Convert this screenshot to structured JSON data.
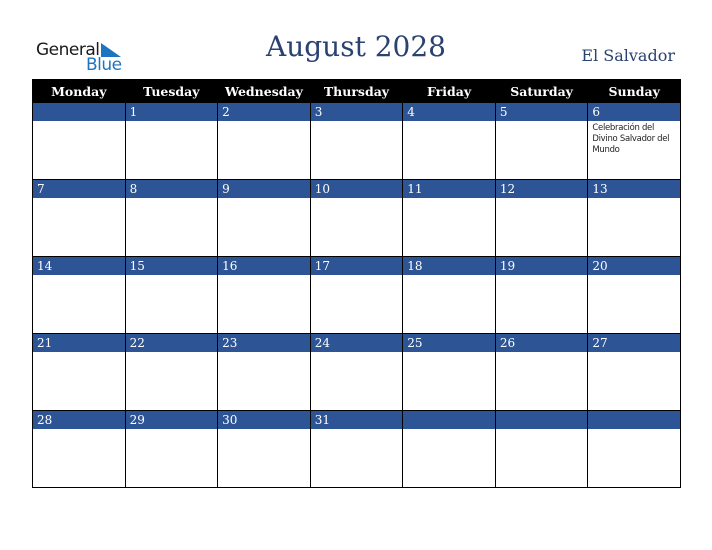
{
  "logo": {
    "line1": "General",
    "line2": "Blue"
  },
  "title": "August 2028",
  "country": "El Salvador",
  "colors": {
    "header_bg": "#000000",
    "day_bar": "#2d5494",
    "title": "#2a4270",
    "logo_blue": "#1f74c1"
  },
  "weekdays": [
    "Monday",
    "Tuesday",
    "Wednesday",
    "Thursday",
    "Friday",
    "Saturday",
    "Sunday"
  ],
  "weeks": [
    {
      "days": [
        {
          "num": "",
          "event": ""
        },
        {
          "num": "1",
          "event": ""
        },
        {
          "num": "2",
          "event": ""
        },
        {
          "num": "3",
          "event": ""
        },
        {
          "num": "4",
          "event": ""
        },
        {
          "num": "5",
          "event": ""
        },
        {
          "num": "6",
          "event": "Celebración del Divino Salvador del Mundo"
        }
      ]
    },
    {
      "days": [
        {
          "num": "7",
          "event": ""
        },
        {
          "num": "8",
          "event": ""
        },
        {
          "num": "9",
          "event": ""
        },
        {
          "num": "10",
          "event": ""
        },
        {
          "num": "11",
          "event": ""
        },
        {
          "num": "12",
          "event": ""
        },
        {
          "num": "13",
          "event": ""
        }
      ]
    },
    {
      "days": [
        {
          "num": "14",
          "event": ""
        },
        {
          "num": "15",
          "event": ""
        },
        {
          "num": "16",
          "event": ""
        },
        {
          "num": "17",
          "event": ""
        },
        {
          "num": "18",
          "event": ""
        },
        {
          "num": "19",
          "event": ""
        },
        {
          "num": "20",
          "event": ""
        }
      ]
    },
    {
      "days": [
        {
          "num": "21",
          "event": ""
        },
        {
          "num": "22",
          "event": ""
        },
        {
          "num": "23",
          "event": ""
        },
        {
          "num": "24",
          "event": ""
        },
        {
          "num": "25",
          "event": ""
        },
        {
          "num": "26",
          "event": ""
        },
        {
          "num": "27",
          "event": ""
        }
      ]
    },
    {
      "days": [
        {
          "num": "28",
          "event": ""
        },
        {
          "num": "29",
          "event": ""
        },
        {
          "num": "30",
          "event": ""
        },
        {
          "num": "31",
          "event": ""
        },
        {
          "num": "",
          "event": ""
        },
        {
          "num": "",
          "event": ""
        },
        {
          "num": "",
          "event": ""
        }
      ]
    }
  ]
}
